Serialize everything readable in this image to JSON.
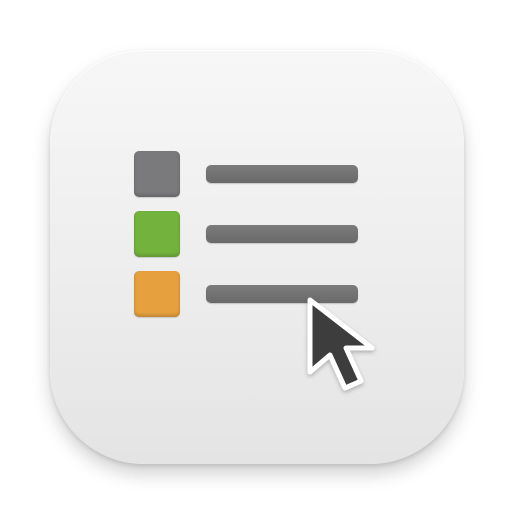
{
  "icon": {
    "name": "list-cursor-app-icon",
    "background_color": "#eeeeee"
  },
  "list": {
    "items": [
      {
        "color": "#7a7a7d",
        "icon": "gray-square"
      },
      {
        "color": "#73b33d",
        "icon": "green-square"
      },
      {
        "color": "#e6a03d",
        "icon": "orange-square"
      }
    ],
    "line_color": "#707070"
  },
  "cursor": {
    "icon": "arrow-cursor",
    "fill": "#3d3d3d",
    "outline": "#ffffff"
  }
}
